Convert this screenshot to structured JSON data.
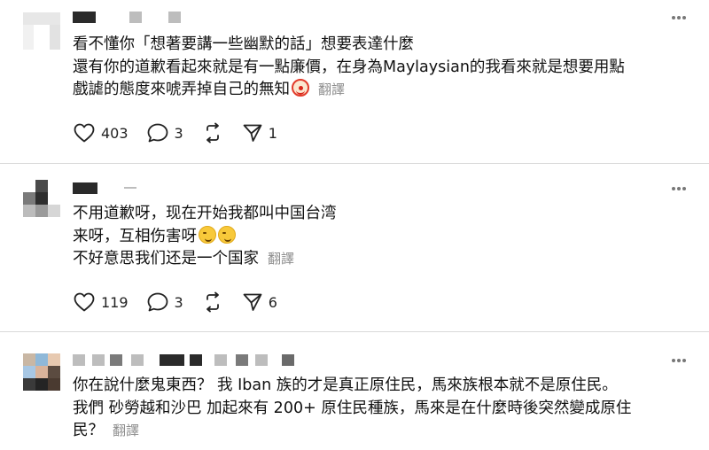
{
  "posts": [
    {
      "lines": [
        "看不懂你「想著要講一些幽默的話」想要表達什麼",
        "還有你的道歉看起來就是有一點廉價，在身為Maylaysian的我看來就是想要用點",
        "戲謔的態度來唬弄掉自己的無知"
      ],
      "translate": "翻譯",
      "likes": "403",
      "replies": "3",
      "reposts": "",
      "shares": "1"
    },
    {
      "lines": [
        "不用道歉呀，现在开始我都叫中国台湾",
        "来呀，互相伤害呀",
        "不好意思我们还是一个国家"
      ],
      "translate": "翻譯",
      "likes": "119",
      "replies": "3",
      "reposts": "",
      "shares": "6"
    },
    {
      "lines": [
        "你在說什麼鬼東西？ 我 Iban 族的才是真正原住民，馬來族根本就不是原住民。",
        "我們 砂勞越和沙巴 加起來有 200+ 原住民種族，馬來是在什麼時後突然變成原住",
        "民？"
      ],
      "translate": "翻譯"
    }
  ],
  "icons": {
    "like": "heart-icon",
    "reply": "speech-bubble-icon",
    "repost": "repost-icon",
    "share": "send-icon",
    "more": "more-dots-icon",
    "emoji_clown": "clown-face-emoji",
    "emoji_smirk": "smirking-face-emoji"
  }
}
